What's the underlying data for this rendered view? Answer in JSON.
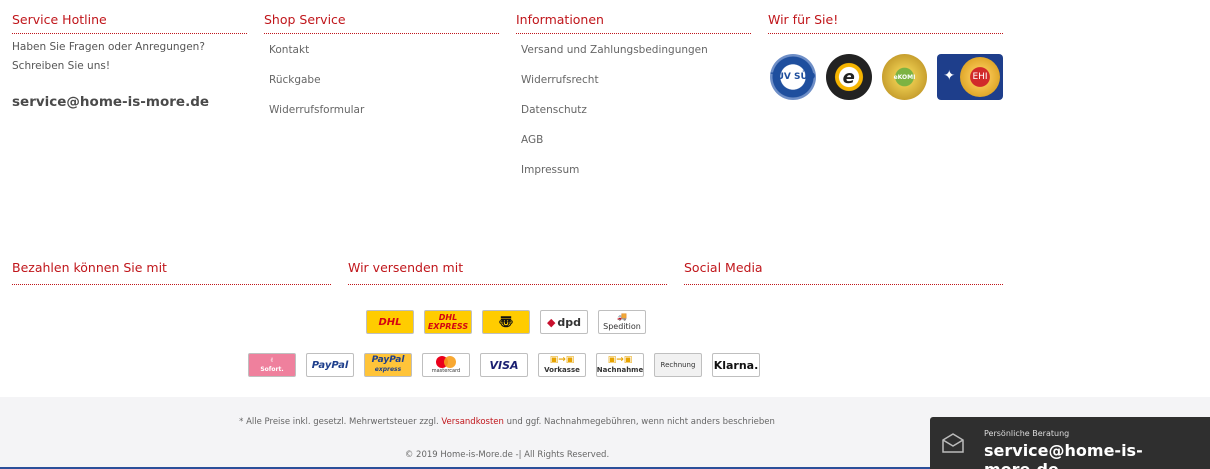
{
  "columns": {
    "service": {
      "title": "Service Hotline",
      "text": "Haben Sie Fragen oder Anregungen? Schreiben Sie uns!",
      "email": "service@home-is-more.de"
    },
    "shop_service": {
      "title": "Shop Service",
      "links": [
        "Kontakt",
        "Rückgabe",
        "Widerrufsformular"
      ]
    },
    "informationen": {
      "title": "Informationen",
      "links": [
        "Versand und Zahlungsbedingungen",
        "Widerrufsrecht",
        "Datenschutz",
        "AGB",
        "Impressum"
      ]
    },
    "wir_fuer_sie": {
      "title": "Wir für Sie!",
      "seals": {
        "tuv": "TÜV SÜD",
        "trusted": "e",
        "ekomi": "eKOMI",
        "ehi": "EHI"
      }
    }
  },
  "sections": {
    "payment_title": "Bezahlen können Sie mit",
    "shipping_title": "Wir versenden mit",
    "social_title": "Social Media"
  },
  "shipping_badges": {
    "dhl": "DHL",
    "dhl_express_1": "DHL",
    "dhl_express_2": "EXPRESS",
    "post": "〠",
    "dpd": "dpd",
    "spedition": "Spedition"
  },
  "payment_badges": {
    "sofort": "Sofort.",
    "paypal": "PayPal",
    "paypal_express_1": "PayPal",
    "paypal_express_2": "express",
    "mastercard": "mastercard",
    "visa": "VISA",
    "vorkasse": "Vorkasse",
    "nachnahme": "Nachnahme",
    "rechnung": "Rechnung",
    "klarna": "Klarna."
  },
  "footer": {
    "note_prefix": "* Alle Preise inkl. gesetzl. Mehrwertsteuer zzgl.",
    "note_link": "Versandkosten",
    "note_suffix": "und ggf. Nachnahmegebühren, wenn nicht anders beschrieben",
    "copyright": "© 2019 Home-is-More.de -| All Rights Reserved."
  },
  "chat": {
    "label": "Persönliche Beratung",
    "email": "service@home-is-more.de"
  },
  "colors": {
    "accent": "#c0161b",
    "footer_bg": "#f4f4f6",
    "chat_bg": "#2f2f2f"
  }
}
